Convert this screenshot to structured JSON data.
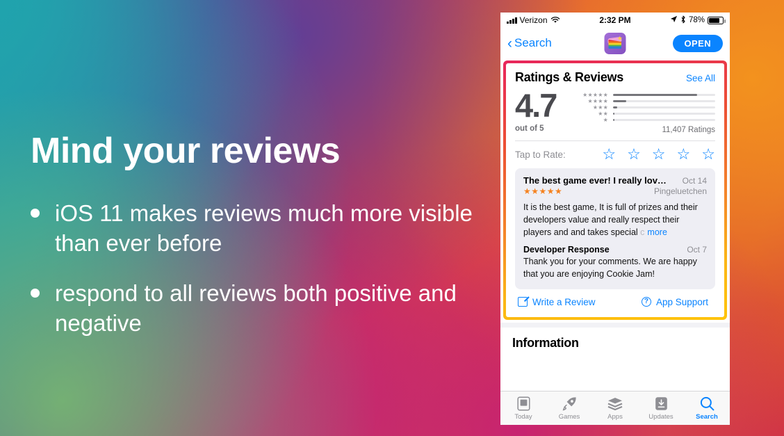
{
  "slide": {
    "headline": "Mind your reviews",
    "bullets": [
      "iOS 11 makes reviews much more visible than ever before",
      "respond to all reviews both positive and negative"
    ]
  },
  "phone": {
    "status_bar": {
      "carrier": "Verizon",
      "wifi_icon": "wifi-icon",
      "time": "2:32 PM",
      "location_icon": "location-arrow-icon",
      "bluetooth_icon": "bluetooth-icon",
      "battery_percent": "78%",
      "battery_level": 78
    },
    "nav": {
      "back_label": "Search",
      "back_icon": "chevron-left-icon",
      "app_icon": "cookie-jam-app-icon",
      "open_label": "OPEN"
    },
    "ratings_section": {
      "title": "Ratings & Reviews",
      "see_all": "See All",
      "score": "4.7",
      "score_sub": "out of 5",
      "ratings_count": "11,407 Ratings",
      "histogram": [
        {
          "stars": "★★★★★",
          "percent": 82
        },
        {
          "stars": "★★★★",
          "percent": 13
        },
        {
          "stars": "★★★",
          "percent": 4
        },
        {
          "stars": "★★",
          "percent": 1.2
        },
        {
          "stars": "★",
          "percent": 1.2
        }
      ],
      "tap_to_rate_label": "Tap to Rate:",
      "tap_stars": [
        "☆",
        "☆",
        "☆",
        "☆",
        "☆"
      ]
    },
    "review": {
      "title": "The best game ever! I really lov…",
      "date": "Oct 14",
      "stars": "★★★★★",
      "author": "Pingeluetchen",
      "body_visible": "It is the best game, It is full of prizes and their developers value and really respect their players and and takes special ",
      "body_fade": "c",
      "more_label": "more",
      "developer_response": {
        "title": "Developer Response",
        "date": "Oct 7",
        "body": "Thank you for your comments. We are happy that you are enjoying Cookie Jam!"
      }
    },
    "actions": {
      "write_review": "Write a Review",
      "write_review_icon": "compose-icon",
      "app_support": "App Support",
      "app_support_icon": "question-circle-icon"
    },
    "information": {
      "title": "Information"
    },
    "tabbar": [
      {
        "label": "Today",
        "icon": "today-document-icon",
        "active": false
      },
      {
        "label": "Games",
        "icon": "rocket-icon",
        "active": false
      },
      {
        "label": "Apps",
        "icon": "stack-layers-icon",
        "active": false
      },
      {
        "label": "Updates",
        "icon": "download-arrow-icon",
        "active": false
      },
      {
        "label": "Search",
        "icon": "magnifier-icon",
        "active": true
      }
    ]
  },
  "colors": {
    "ios_blue": "#0a84ff",
    "star_orange": "#f5821f",
    "highlight_gradient_start": "#e8265c",
    "highlight_gradient_end": "#ffc40a",
    "review_card_bg": "#eeeef4"
  }
}
